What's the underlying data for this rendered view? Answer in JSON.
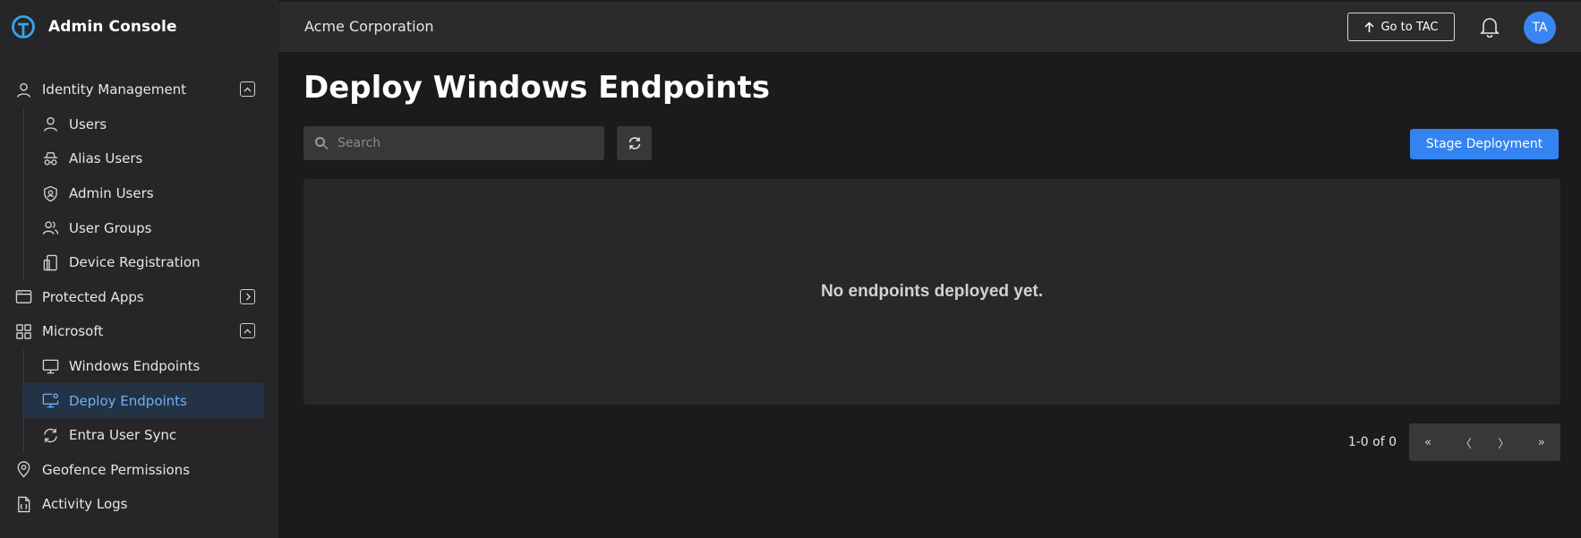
{
  "app": {
    "title": "Admin Console",
    "logo_icon": "console-logo"
  },
  "colors": {
    "accent": "#3384f0",
    "active_text": "#6fb1f5",
    "active_bg": "#243245"
  },
  "sidebar": {
    "identity": {
      "label": "Identity Management",
      "icon": "user-icon",
      "toggle": "collapse"
    },
    "identity_children": [
      {
        "label": "Users",
        "icon": "user-icon"
      },
      {
        "label": "Alias Users",
        "icon": "incognito-icon"
      },
      {
        "label": "Admin Users",
        "icon": "shield-user-icon"
      },
      {
        "label": "User Groups",
        "icon": "users-icon"
      },
      {
        "label": "Device Registration",
        "icon": "device-icon"
      }
    ],
    "protected_apps": {
      "label": "Protected Apps",
      "icon": "app-window-icon",
      "toggle": "expand"
    },
    "microsoft": {
      "label": "Microsoft",
      "icon": "grid-icon",
      "toggle": "collapse"
    },
    "microsoft_children": [
      {
        "label": "Windows Endpoints",
        "icon": "monitor-icon"
      },
      {
        "label": "Deploy Endpoints",
        "icon": "monitor-gear-icon",
        "active": true
      },
      {
        "label": "Entra User Sync",
        "icon": "sync-icon"
      }
    ],
    "geofence": {
      "label": "Geofence Permissions",
      "icon": "location-pin-icon"
    },
    "activity_logs": {
      "label": "Activity Logs",
      "icon": "log-file-icon"
    }
  },
  "header": {
    "org_name": "Acme Corporation",
    "tac_button": "Go to TAC",
    "avatar_initials": "TA"
  },
  "main": {
    "title": "Deploy Windows Endpoints",
    "search_placeholder": "Search",
    "search_value": "",
    "stage_button": "Stage Deployment",
    "empty_message": "No endpoints deployed yet.",
    "pagination": {
      "summary": "1-0 of 0",
      "first": "«",
      "prev": "〈",
      "next": "〉",
      "last": "»"
    }
  }
}
